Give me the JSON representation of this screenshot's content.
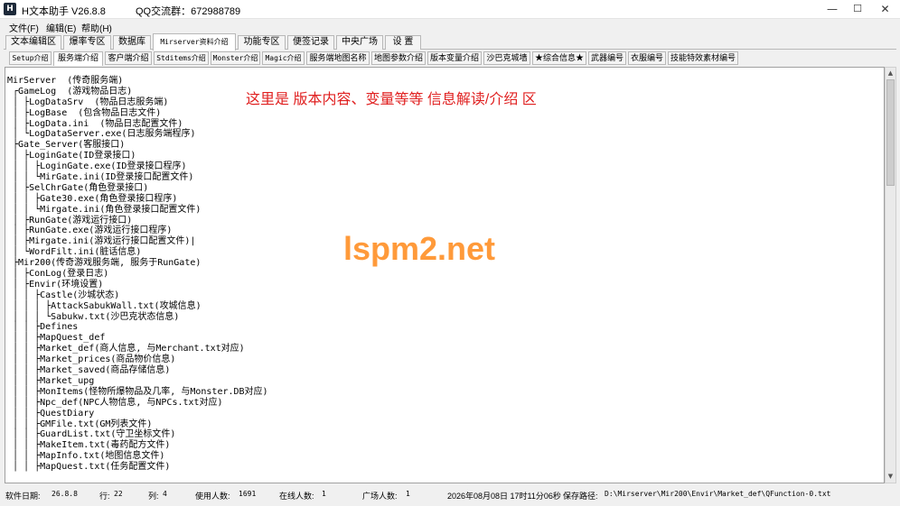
{
  "window": {
    "icon_letter": "H",
    "title": "H文本助手  V26.8.8",
    "qq_group": "QQ交流群：672988789",
    "minimize_glyph": "—",
    "maximize_glyph": "☐",
    "close_glyph": "✕"
  },
  "menu": {
    "items": [
      "文件(F)",
      "编辑(E)",
      "帮助(H)"
    ]
  },
  "tabs_top": {
    "items": [
      "文本编辑区",
      "爆率专区",
      "数据库",
      "Mirserver资料介绍",
      "功能专区",
      "便签记录",
      "中央广场",
      "设  置"
    ],
    "active_index": 3
  },
  "tabs_sub": {
    "items": [
      "Setup介绍",
      "服务端介绍",
      "客户端介绍",
      "Stditems介绍",
      "Monster介绍",
      "Magic介绍",
      "服务端地图名称",
      "地图参数介绍",
      "版本变量介绍",
      "沙巴克城墙",
      "★综合信息★",
      "武器编号",
      "衣服编号",
      "技能特效素材编号"
    ],
    "active_index": 1
  },
  "content": {
    "overlay_note": "这里是 版本内容、变量等等  信息解读/介绍 区",
    "watermark": "lspm2.net",
    "tree_lines": [
      "MirServer  (传奇服务端)",
      " ┌GameLog  (游戏物品日志)",
      " │ ├LogDataSrv  (物品日志服务端)",
      " │ ├LogBase  (包含物品日志文件)",
      " │ ├LogData.ini  (物品日志配置文件)",
      " │ └LogDataServer.exe(日志服务端程序)",
      " ├Gate_Server(客服接口)",
      " │ ├LoginGate(ID登录接口)",
      " │ │ ├LoginGate.exe(ID登录接口程序)",
      " │ │ └MirGate.ini(ID登录接口配置文件)",
      " │ ├SelChrGate(角色登录接口)",
      " │ │ ├Gate30.exe(角色登录接口程序)",
      " │ │ └Mirgate.ini(角色登录接口配置文件)",
      " │ ├RunGate(游戏运行接口)",
      " │ ├RunGate.exe(游戏运行接口程序)",
      " │ ├Mirgate.ini(游戏运行接口配置文件)|",
      " │ └WordFilt.ini(脏话信息)",
      " ├Mir200(传奇游戏服务端, 服务于RunGate)",
      " │ ├ConLog(登录日志)",
      " │ ├Envir(环境设置)",
      " │ │ ├Castle(沙城状态)",
      " │ │ │ ├AttackSabukWall.txt(攻城信息)",
      " │ │ │ └Sabukw.txt(沙巴克状态信息)",
      " │ │ ├Defines",
      " │ │ ├MapQuest_def",
      " │ │ ├Market_def(商人信息, 与Merchant.txt对应)",
      " │ │ ├Market_prices(商品物价信息)",
      " │ │ ├Market_saved(商品存储信息)",
      " │ │ ├Market_upg",
      " │ │ ├MonItems(怪物所爆物品及几率, 与Monster.DB对应)",
      " │ │ ├Npc_def(NPC人物信息, 与NPCs.txt对应)",
      " │ │ ├QuestDiary",
      " │ │ ├GMFile.txt(GM列表文件)",
      " │ │ ├GuardList.txt(守卫坐标文件)",
      " │ │ ├MakeItem.txt(毒药配方文件)",
      " │ │ ├MapInfo.txt(地图信息文件)",
      " │ │ ├MapQuest.txt(任务配置文件)"
    ]
  },
  "scrollbar": {
    "up_glyph": "▲",
    "down_glyph": "▼",
    "position_fraction": 0.0
  },
  "status": {
    "software_date_label": "软件日期:",
    "software_date_value": "26.8.8",
    "line_label": "行:",
    "line_value": "22",
    "col_label": "列:",
    "col_value": "4",
    "users_label": "使用人数:",
    "users_value": "1691",
    "online_label": "在线人数:",
    "online_value": "1",
    "plaza_label": "广场人数:",
    "plaza_value": "1",
    "datetime": "2026年08月08日 17时11分06秒",
    "save_path_label": "保存路径:",
    "save_path_value": "D:\\Mirserver\\Mir200\\Envir\\Market_def\\QFunction-0.txt"
  },
  "colors": {
    "overlay_note": "#e02020",
    "watermark": "#ff9a3a",
    "content_bg": "#ffffff",
    "chrome_bg": "#f0f0f0"
  }
}
